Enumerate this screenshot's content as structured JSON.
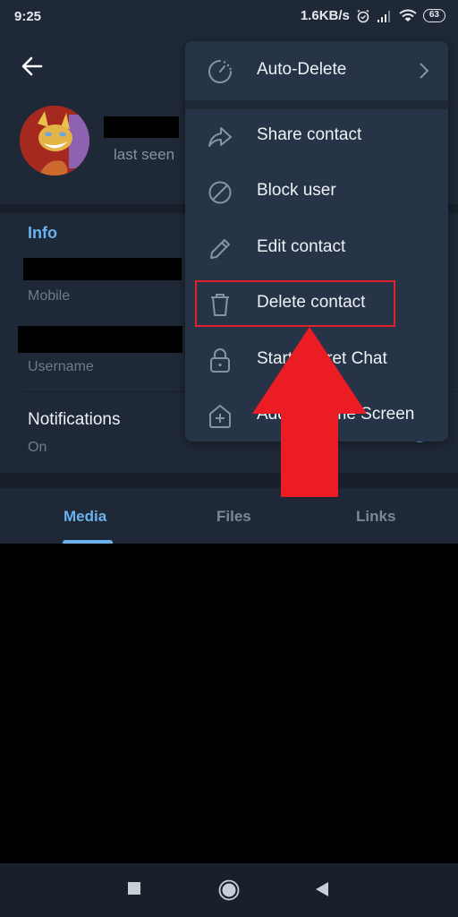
{
  "status_bar": {
    "time": "9:25",
    "network_speed": "1.6KB/s",
    "alarm_icon": "alarm-icon",
    "signal_icon": "signal-icon",
    "wifi_icon": "wifi-icon",
    "battery": "63"
  },
  "header": {
    "back_icon": "arrow-left-icon",
    "contact_name": "[redacted]",
    "last_seen": "last seen"
  },
  "info": {
    "section_title": "Info",
    "phone_value": "[redacted]",
    "phone_label": "Mobile",
    "username_value": "[redacted]",
    "username_label": "Username",
    "notifications_title": "Notifications",
    "notifications_value": "On"
  },
  "tabs": [
    {
      "label": "Media",
      "active": true
    },
    {
      "label": "Files",
      "active": false
    },
    {
      "label": "Links",
      "active": false
    }
  ],
  "menu": {
    "items": [
      {
        "label": "Auto-Delete",
        "icon": "timer-icon",
        "has_submenu": true
      },
      {
        "label": "Share contact",
        "icon": "share-icon"
      },
      {
        "label": "Block user",
        "icon": "block-icon"
      },
      {
        "label": "Edit contact",
        "icon": "pencil-icon"
      },
      {
        "label": "Delete contact",
        "icon": "trash-icon",
        "highlighted": true
      },
      {
        "label": "Start Secret Chat",
        "icon": "lock-icon"
      },
      {
        "label": "Add to Home Screen",
        "icon": "home-add-icon"
      }
    ]
  },
  "annotation": {
    "highlight_color": "#e3212b",
    "arrow_color": "#ec1c24",
    "target": "Delete contact"
  },
  "nav_bar": {
    "recents_icon": "square-icon",
    "home_icon": "circle-home-icon",
    "back_icon": "triangle-back-icon"
  },
  "colors": {
    "background": "#1f2836",
    "accent": "#6ab2ef",
    "menu_background": "#273447"
  }
}
